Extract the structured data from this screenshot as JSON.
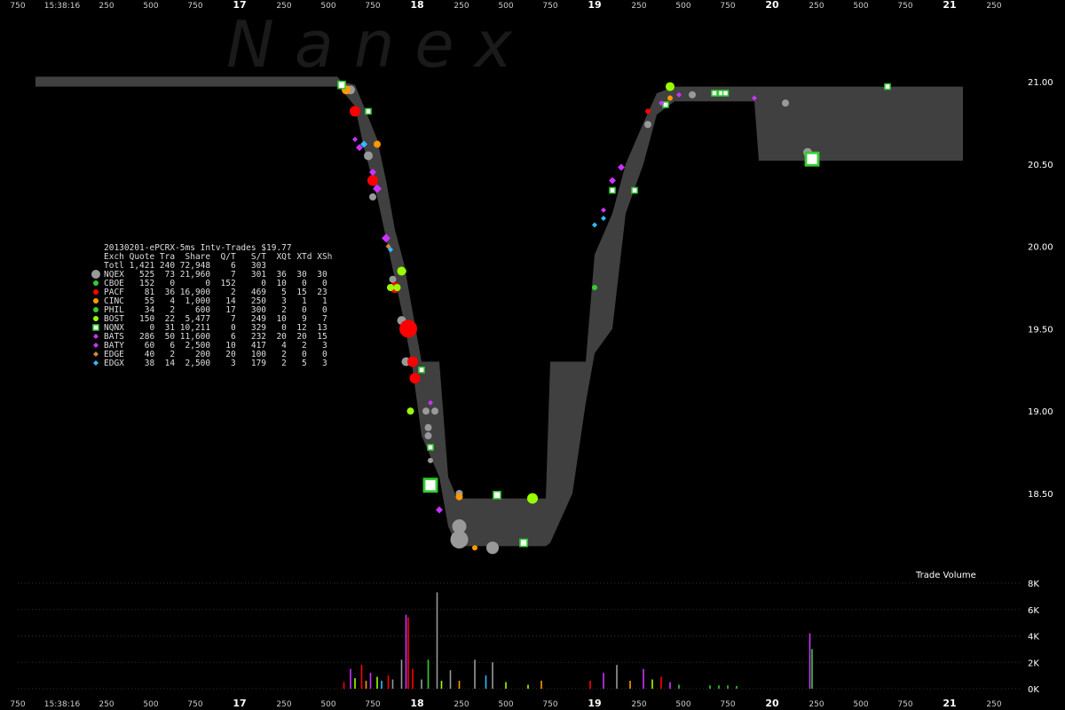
{
  "watermark": "N a n e x",
  "time_axis": {
    "labels": [
      {
        "t": 0,
        "label": "750",
        "major": false
      },
      {
        "t": 1,
        "label": "15:38:16",
        "major": false
      },
      {
        "t": 2,
        "label": "250",
        "major": false
      },
      {
        "t": 3,
        "label": "500",
        "major": false
      },
      {
        "t": 4,
        "label": "750",
        "major": false
      },
      {
        "t": 5,
        "label": "17",
        "major": true
      },
      {
        "t": 6,
        "label": "250",
        "major": false
      },
      {
        "t": 7,
        "label": "500",
        "major": false
      },
      {
        "t": 8,
        "label": "750",
        "major": false
      },
      {
        "t": 9,
        "label": "18",
        "major": true
      },
      {
        "t": 10,
        "label": "250",
        "major": false
      },
      {
        "t": 11,
        "label": "500",
        "major": false
      },
      {
        "t": 12,
        "label": "750",
        "major": false
      },
      {
        "t": 13,
        "label": "19",
        "major": true
      },
      {
        "t": 14,
        "label": "250",
        "major": false
      },
      {
        "t": 15,
        "label": "500",
        "major": false
      },
      {
        "t": 16,
        "label": "750",
        "major": false
      },
      {
        "t": 17,
        "label": "20",
        "major": true
      },
      {
        "t": 18,
        "label": "250",
        "major": false
      },
      {
        "t": 19,
        "label": "500",
        "major": false
      },
      {
        "t": 20,
        "label": "750",
        "major": false
      },
      {
        "t": 21,
        "label": "21",
        "major": true
      },
      {
        "t": 22,
        "label": "250",
        "major": false
      }
    ]
  },
  "chart_data": [
    {
      "type": "scatter",
      "title": "20130201-ePCRX-5ms Intv-Trades $19.77",
      "ylim": [
        18.0,
        21.15
      ],
      "y_ticks": [
        "21.00",
        "20.50",
        "20.00",
        "19.50",
        "19.00",
        "18.50"
      ],
      "y_tick_values": [
        21.0,
        20.5,
        20.0,
        19.5,
        19.0,
        18.5
      ],
      "xlim": [
        0,
        23
      ],
      "nbbo_band": [
        {
          "t": 0.4,
          "lo": 20.97,
          "hi": 21.03
        },
        {
          "t": 7.2,
          "lo": 20.97,
          "hi": 21.03
        },
        {
          "t": 7.3,
          "lo": 20.95,
          "hi": 21.0
        },
        {
          "t": 7.6,
          "lo": 20.85,
          "hi": 20.98
        },
        {
          "t": 7.8,
          "lo": 20.6,
          "hi": 20.85
        },
        {
          "t": 8.1,
          "lo": 20.3,
          "hi": 20.65
        },
        {
          "t": 8.3,
          "lo": 20.05,
          "hi": 20.4
        },
        {
          "t": 8.5,
          "lo": 19.8,
          "hi": 20.1
        },
        {
          "t": 8.7,
          "lo": 19.55,
          "hi": 19.9
        },
        {
          "t": 8.9,
          "lo": 19.25,
          "hi": 19.6
        },
        {
          "t": 9.1,
          "lo": 18.85,
          "hi": 19.3
        },
        {
          "t": 9.5,
          "lo": 18.6,
          "hi": 19.3
        },
        {
          "t": 9.7,
          "lo": 18.3,
          "hi": 18.6
        },
        {
          "t": 9.9,
          "lo": 18.18,
          "hi": 18.47
        },
        {
          "t": 11.9,
          "lo": 18.18,
          "hi": 18.47
        },
        {
          "t": 12.0,
          "lo": 18.2,
          "hi": 19.3
        },
        {
          "t": 12.5,
          "lo": 18.5,
          "hi": 19.3
        },
        {
          "t": 12.8,
          "lo": 19.05,
          "hi": 19.3
        },
        {
          "t": 13.0,
          "lo": 19.35,
          "hi": 19.95
        },
        {
          "t": 13.4,
          "lo": 19.5,
          "hi": 20.2
        },
        {
          "t": 13.7,
          "lo": 20.2,
          "hi": 20.5
        },
        {
          "t": 14.1,
          "lo": 20.5,
          "hi": 20.75
        },
        {
          "t": 14.4,
          "lo": 20.8,
          "hi": 20.93
        },
        {
          "t": 14.8,
          "lo": 20.88,
          "hi": 20.97
        },
        {
          "t": 16.6,
          "lo": 20.88,
          "hi": 20.97
        },
        {
          "t": 16.7,
          "lo": 20.52,
          "hi": 20.97
        },
        {
          "t": 21.3,
          "lo": 20.52,
          "hi": 20.97
        }
      ],
      "series": [
        {
          "name": "NQEX",
          "color": "#999999",
          "shape": "circle",
          "points": [
            {
              "t": 7.5,
              "y": 20.95,
              "s": 5
            },
            {
              "t": 7.9,
              "y": 20.55,
              "s": 5
            },
            {
              "t": 8.0,
              "y": 20.3,
              "s": 4
            },
            {
              "t": 8.45,
              "y": 19.8,
              "s": 4
            },
            {
              "t": 8.65,
              "y": 19.55,
              "s": 5
            },
            {
              "t": 8.75,
              "y": 19.3,
              "s": 5
            },
            {
              "t": 9.2,
              "y": 19.0,
              "s": 4
            },
            {
              "t": 9.4,
              "y": 19.0,
              "s": 4
            },
            {
              "t": 9.25,
              "y": 18.9,
              "s": 4
            },
            {
              "t": 9.25,
              "y": 18.85,
              "s": 4
            },
            {
              "t": 9.3,
              "y": 18.7,
              "s": 3
            },
            {
              "t": 9.95,
              "y": 18.5,
              "s": 4
            },
            {
              "t": 9.95,
              "y": 18.3,
              "s": 8
            },
            {
              "t": 9.95,
              "y": 18.22,
              "s": 10
            },
            {
              "t": 10.7,
              "y": 18.17,
              "s": 7
            },
            {
              "t": 14.2,
              "y": 20.74,
              "s": 4
            },
            {
              "t": 15.2,
              "y": 20.92,
              "s": 4
            },
            {
              "t": 17.3,
              "y": 20.87,
              "s": 4
            },
            {
              "t": 17.8,
              "y": 20.57,
              "s": 5
            }
          ]
        },
        {
          "name": "CBOE",
          "color": "#33cc33",
          "shape": "circle",
          "points": [
            {
              "t": 13.0,
              "y": 19.75,
              "s": 3
            }
          ]
        },
        {
          "name": "PACF",
          "color": "#ff0000",
          "shape": "circle",
          "points": [
            {
              "t": 7.6,
              "y": 20.82,
              "s": 6
            },
            {
              "t": 8.0,
              "y": 20.4,
              "s": 6
            },
            {
              "t": 8.5,
              "y": 19.75,
              "s": 6
            },
            {
              "t": 8.8,
              "y": 19.5,
              "s": 10
            },
            {
              "t": 8.9,
              "y": 19.3,
              "s": 6
            },
            {
              "t": 8.95,
              "y": 19.2,
              "s": 6
            },
            {
              "t": 14.2,
              "y": 20.82,
              "s": 3
            }
          ]
        },
        {
          "name": "CINC",
          "color": "#ff9900",
          "shape": "circle",
          "points": [
            {
              "t": 7.4,
              "y": 20.95,
              "s": 5
            },
            {
              "t": 8.1,
              "y": 20.62,
              "s": 4
            },
            {
              "t": 9.95,
              "y": 18.48,
              "s": 4
            },
            {
              "t": 10.3,
              "y": 18.17,
              "s": 3
            },
            {
              "t": 14.7,
              "y": 20.9,
              "s": 3
            }
          ]
        },
        {
          "name": "PHIL",
          "color": "#33cc33",
          "shape": "circle",
          "points": [
            {
              "t": 8.7,
              "y": 19.85,
              "s": 3
            }
          ]
        },
        {
          "name": "BOST",
          "color": "#99ff00",
          "shape": "circle",
          "points": [
            {
              "t": 8.4,
              "y": 19.75,
              "s": 4
            },
            {
              "t": 8.55,
              "y": 19.75,
              "s": 4
            },
            {
              "t": 8.65,
              "y": 19.85,
              "s": 5
            },
            {
              "t": 8.85,
              "y": 19.0,
              "s": 4
            },
            {
              "t": 11.6,
              "y": 18.47,
              "s": 6
            },
            {
              "t": 14.7,
              "y": 20.97,
              "s": 5
            }
          ]
        },
        {
          "name": "NQNX",
          "color": "#33cc33",
          "shape": "square",
          "points": [
            {
              "t": 7.3,
              "y": 20.98,
              "s": 4
            },
            {
              "t": 7.9,
              "y": 20.82,
              "s": 3
            },
            {
              "t": 9.1,
              "y": 19.25,
              "s": 3
            },
            {
              "t": 9.3,
              "y": 18.78,
              "s": 3
            },
            {
              "t": 9.3,
              "y": 18.55,
              "s": 7
            },
            {
              "t": 10.8,
              "y": 18.49,
              "s": 4
            },
            {
              "t": 11.4,
              "y": 18.2,
              "s": 4
            },
            {
              "t": 13.4,
              "y": 20.34,
              "s": 3
            },
            {
              "t": 13.9,
              "y": 20.34,
              "s": 3
            },
            {
              "t": 14.6,
              "y": 20.86,
              "s": 3
            },
            {
              "t": 15.7,
              "y": 20.93,
              "s": 3
            },
            {
              "t": 15.85,
              "y": 20.93,
              "s": 3
            },
            {
              "t": 15.95,
              "y": 20.93,
              "s": 3
            },
            {
              "t": 19.6,
              "y": 20.97,
              "s": 3
            },
            {
              "t": 17.9,
              "y": 20.53,
              "s": 7
            }
          ]
        },
        {
          "name": "BATS",
          "color": "#cc33ff",
          "shape": "diamond",
          "points": [
            {
              "t": 7.7,
              "y": 20.6,
              "s": 4
            },
            {
              "t": 8.0,
              "y": 20.45,
              "s": 4
            },
            {
              "t": 8.1,
              "y": 20.35,
              "s": 5
            },
            {
              "t": 8.3,
              "y": 20.05,
              "s": 5
            },
            {
              "t": 9.3,
              "y": 19.05,
              "s": 3
            },
            {
              "t": 9.5,
              "y": 18.4,
              "s": 4
            },
            {
              "t": 13.4,
              "y": 20.4,
              "s": 4
            },
            {
              "t": 13.6,
              "y": 20.48,
              "s": 4
            },
            {
              "t": 14.9,
              "y": 20.92,
              "s": 3
            },
            {
              "t": 16.6,
              "y": 20.9,
              "s": 3
            }
          ]
        },
        {
          "name": "BATY",
          "color": "#cc33ff",
          "shape": "diamond",
          "points": [
            {
              "t": 7.6,
              "y": 20.65,
              "s": 3
            },
            {
              "t": 13.2,
              "y": 20.22,
              "s": 3
            },
            {
              "t": 14.5,
              "y": 20.87,
              "s": 3
            }
          ]
        },
        {
          "name": "EDGE",
          "color": "#cc8844",
          "shape": "diamond",
          "points": [
            {
              "t": 8.35,
              "y": 20.0,
              "s": 3
            }
          ]
        },
        {
          "name": "EDGX",
          "color": "#33bbff",
          "shape": "diamond",
          "points": [
            {
              "t": 7.8,
              "y": 20.62,
              "s": 4
            },
            {
              "t": 8.4,
              "y": 19.98,
              "s": 3
            },
            {
              "t": 13.0,
              "y": 20.13,
              "s": 3
            },
            {
              "t": 13.2,
              "y": 20.17,
              "s": 3
            }
          ]
        }
      ]
    },
    {
      "type": "bar",
      "title": "Trade Volume",
      "ylim": [
        0,
        8000
      ],
      "y_ticks": [
        "8K",
        "6K",
        "4K",
        "2K",
        "0K"
      ],
      "y_tick_values": [
        8000,
        6000,
        4000,
        2000,
        0
      ],
      "bars": [
        {
          "t": 7.35,
          "v": 500,
          "color": "#ff0000"
        },
        {
          "t": 7.5,
          "v": 1500,
          "color": "#cc33ff"
        },
        {
          "t": 7.6,
          "v": 800,
          "color": "#99ff00"
        },
        {
          "t": 7.75,
          "v": 1800,
          "color": "#ff0000"
        },
        {
          "t": 7.85,
          "v": 600,
          "color": "#ff9900"
        },
        {
          "t": 7.95,
          "v": 1200,
          "color": "#cc33ff"
        },
        {
          "t": 8.1,
          "v": 900,
          "color": "#99ff00"
        },
        {
          "t": 8.2,
          "v": 600,
          "color": "#33bbff"
        },
        {
          "t": 8.35,
          "v": 1000,
          "color": "#ff0000"
        },
        {
          "t": 8.45,
          "v": 700,
          "color": "#999999"
        },
        {
          "t": 8.65,
          "v": 2200,
          "color": "#999999"
        },
        {
          "t": 8.75,
          "v": 5600,
          "color": "#cc33ff"
        },
        {
          "t": 8.8,
          "v": 5400,
          "color": "#ff0000"
        },
        {
          "t": 8.9,
          "v": 1500,
          "color": "#ff0000"
        },
        {
          "t": 9.1,
          "v": 700,
          "color": "#999999"
        },
        {
          "t": 9.25,
          "v": 2200,
          "color": "#33cc33"
        },
        {
          "t": 9.45,
          "v": 7300,
          "color": "#999999"
        },
        {
          "t": 9.55,
          "v": 600,
          "color": "#99ff00"
        },
        {
          "t": 9.75,
          "v": 1400,
          "color": "#999999"
        },
        {
          "t": 9.95,
          "v": 600,
          "color": "#ff9900"
        },
        {
          "t": 10.3,
          "v": 2200,
          "color": "#999999"
        },
        {
          "t": 10.55,
          "v": 1000,
          "color": "#33bbff"
        },
        {
          "t": 10.7,
          "v": 2000,
          "color": "#999999"
        },
        {
          "t": 11.0,
          "v": 500,
          "color": "#99ff00"
        },
        {
          "t": 11.5,
          "v": 300,
          "color": "#99ff00"
        },
        {
          "t": 11.8,
          "v": 600,
          "color": "#ff9900"
        },
        {
          "t": 12.9,
          "v": 600,
          "color": "#ff0000"
        },
        {
          "t": 13.2,
          "v": 1200,
          "color": "#cc33ff"
        },
        {
          "t": 13.5,
          "v": 1800,
          "color": "#999999"
        },
        {
          "t": 13.8,
          "v": 600,
          "color": "#ff9900"
        },
        {
          "t": 14.1,
          "v": 1500,
          "color": "#cc33ff"
        },
        {
          "t": 14.3,
          "v": 700,
          "color": "#99ff00"
        },
        {
          "t": 14.5,
          "v": 900,
          "color": "#ff0000"
        },
        {
          "t": 14.7,
          "v": 500,
          "color": "#cc33ff"
        },
        {
          "t": 14.9,
          "v": 300,
          "color": "#33cc33"
        },
        {
          "t": 15.6,
          "v": 250,
          "color": "#33cc33"
        },
        {
          "t": 15.8,
          "v": 250,
          "color": "#33cc33"
        },
        {
          "t": 16.0,
          "v": 250,
          "color": "#33cc33"
        },
        {
          "t": 16.2,
          "v": 200,
          "color": "#33cc33"
        },
        {
          "t": 17.85,
          "v": 4200,
          "color": "#cc33ff"
        },
        {
          "t": 17.9,
          "v": 3000,
          "color": "#33cc33"
        }
      ]
    }
  ],
  "legend": {
    "title": "20130201-ePCRX-5ms Intv-Trades $19.77",
    "header": "Exch Quote Tra  Share  Q/T   S/T  XQt XTd XSh",
    "total": "Totl 1,421 240 72,948    6   303",
    "rows": [
      {
        "name": "NQEX",
        "text": "NQEX   525  73 21,960    7   301  36  30  30",
        "color": "#999999",
        "shape": "circle"
      },
      {
        "name": "CBOE",
        "text": "CBOE   152   0      0  152     0  10   0   0",
        "color": "#33cc33",
        "shape": "circle"
      },
      {
        "name": "PACF",
        "text": "PACF    81  36 16,900    2   469   5  15  23",
        "color": "#ff0000",
        "shape": "circle"
      },
      {
        "name": "CINC",
        "text": "CINC    55   4  1,000   14   250   3   1   1",
        "color": "#ff9900",
        "shape": "circle"
      },
      {
        "name": "PHIL",
        "text": "PHIL    34   2    600   17   300   2   0   0",
        "color": "#33cc33",
        "shape": "circle"
      },
      {
        "name": "BOST",
        "text": "BOST   150  22  5,477    7   249  10   9   7",
        "color": "#99ff00",
        "shape": "circle"
      },
      {
        "name": "NQNX",
        "text": "NQNX     0  31 10,211    0   329   0  12  13",
        "color": "#33cc33",
        "shape": "square"
      },
      {
        "name": "BATS",
        "text": "BATS   286  50 11,600    6   232  20  20  15",
        "color": "#cc33ff",
        "shape": "diamond"
      },
      {
        "name": "BATY",
        "text": "BATY    60   6  2,500   10   417   4   2   3",
        "color": "#cc33ff",
        "shape": "diamond"
      },
      {
        "name": "EDGE",
        "text": "EDGE    40   2    200   20   100   2   0   0",
        "color": "#cc8844",
        "shape": "diamond"
      },
      {
        "name": "EDGX",
        "text": "EDGX    38  14  2,500    3   179   2   5   3",
        "color": "#33bbff",
        "shape": "diamond"
      }
    ]
  },
  "volume_label": "Trade Volume"
}
